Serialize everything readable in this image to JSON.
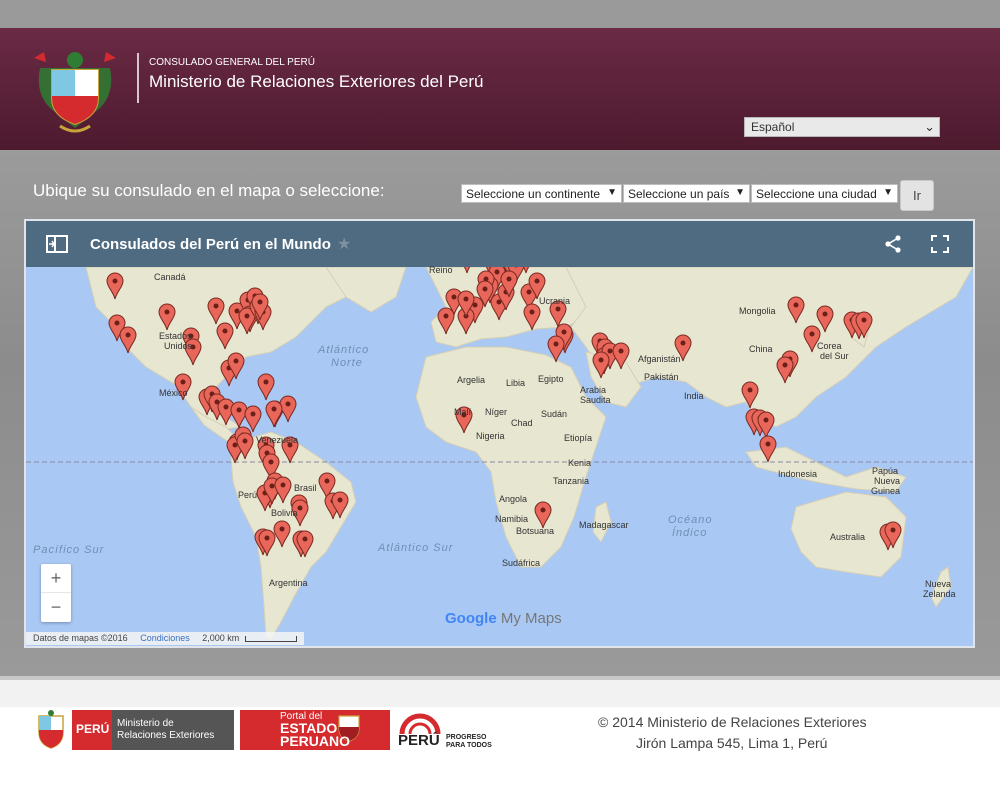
{
  "header": {
    "consulado": "CONSULADO GENERAL DEL PERÚ",
    "ministerio": "Ministerio de Relaciones Exteriores del Perú",
    "language": "Español"
  },
  "locator": {
    "prompt": "Ubique su consulado en el mapa o seleccione:",
    "continent": "Seleccione un continente",
    "country": "Seleccione un país",
    "city": "Seleccione una ciudad",
    "go": "Ir"
  },
  "map": {
    "title": "Consulados del Perú en el Mundo",
    "zoom_in": "+",
    "zoom_out": "−",
    "logo_google": "Google",
    "logo_mymaps": "My Maps",
    "attribution": "Datos de mapas ©2016",
    "terms": "Condiciones",
    "scale": "2,000 km",
    "labels": {
      "canada": "Canadá",
      "estados": "Estados",
      "unidos": "Unidos",
      "mexico": "México",
      "venezuela": "Venezuela",
      "peru": "Perú",
      "brasil": "Brasil",
      "bolivia": "Bolivia",
      "argentina": "Argentina",
      "reino": "Reino",
      "ucrania": "Ucrania",
      "argelia": "Argelia",
      "libia": "Libia",
      "egipto": "Egipto",
      "mali": "Malí",
      "niger": "Níger",
      "chad": "Chad",
      "sudan": "Sudán",
      "nigeria": "Nigeria",
      "etiopia": "Etiopía",
      "kenia": "Kenia",
      "tanzania": "Tanzania",
      "angola": "Angola",
      "namibia": "Namibia",
      "botsuana": "Botsuana",
      "sudafrica": "Sudáfrica",
      "madagascar": "Madagascar",
      "arabia": "Arabia",
      "saudita": "Saudita",
      "afganistan": "Afganistán",
      "pakistan": "Pakistán",
      "india": "India",
      "mongolia": "Mongolia",
      "china": "China",
      "corea": "Corea",
      "del_sur": "del Sur",
      "indonesia": "Indonesia",
      "papua": "Papúa",
      "nueva_guinea": "Nueva",
      "guinea": "Guinea",
      "australia": "Australia",
      "nueva_zelanda_1": "Nueva",
      "nueva_zelanda_2": "Zelanda"
    },
    "oceans": {
      "atlantico_norte_1": "Atlántico",
      "atlantico_norte_2": "Norte",
      "atlantico_sur": "Atlántico Sur",
      "pacifico_sur": "Pacífico Sur",
      "indico_1": "Océano",
      "indico_2": "Índico"
    },
    "pin_color": "#e8665a",
    "water_color": "#a9c8f4",
    "land_color": "#e7e6d0"
  },
  "footer": {
    "peru": "PERÚ",
    "mrree_1": "Ministerio de",
    "mrree_2": "Relaciones Exteriores",
    "estado_1": "Portal del",
    "estado_2": "ESTADO",
    "estado_3": "PERUANO",
    "progreso_peru": "PERÚ",
    "progreso_1": "PROGRESO",
    "progreso_2": "PARA TODOS",
    "copyright": "© 2014 Ministerio de Relaciones Exteriores",
    "address": "Jirón Lampa 545, Lima 1, Perú"
  }
}
